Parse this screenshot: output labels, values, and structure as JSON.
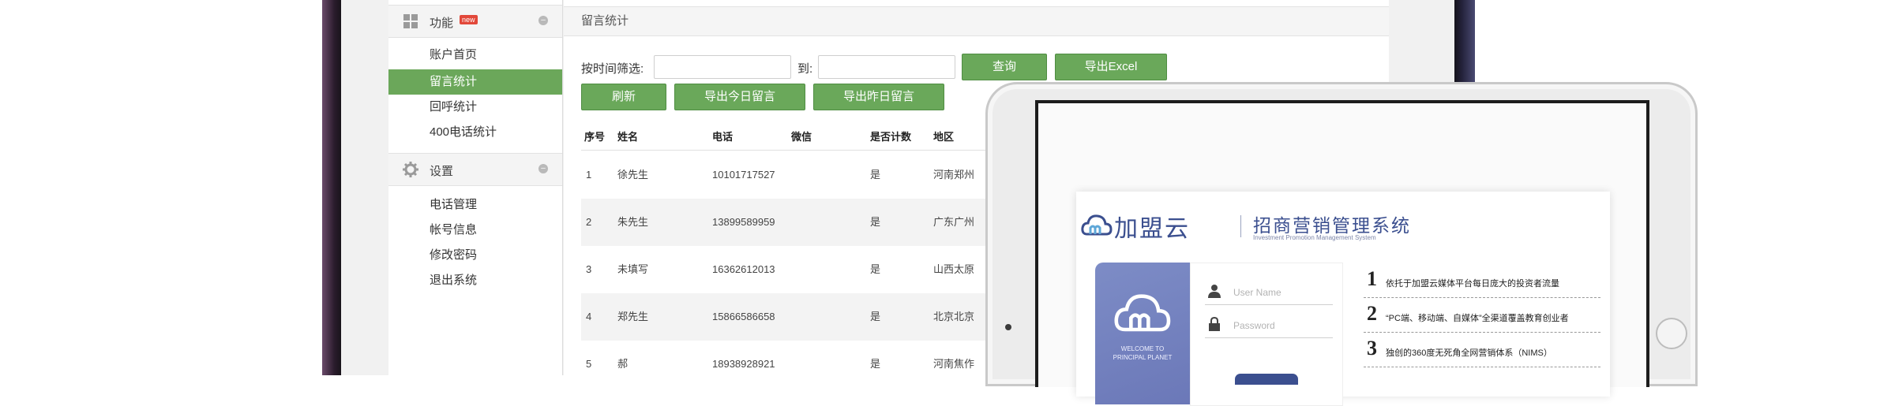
{
  "sidebar": {
    "groups": [
      {
        "title": "功能",
        "badge": "new",
        "items": [
          "账户首页",
          "留言统计",
          "回呼统计",
          "400电话统计"
        ]
      },
      {
        "title": "设置",
        "items": [
          "电话管理",
          "帐号信息",
          "修改密码",
          "退出系统"
        ]
      }
    ],
    "active_item": "留言统计"
  },
  "main": {
    "breadcrumb": "留言统计",
    "filter": {
      "label": "按时间筛选:",
      "to_label": "到:",
      "from_value": "",
      "to_value": ""
    },
    "buttons": {
      "query": "查询",
      "export_excel": "导出Excel",
      "refresh": "刷新",
      "export_today": "导出今日留言",
      "export_yesterday": "导出昨日留言"
    },
    "table": {
      "headers": [
        "序号",
        "姓名",
        "电话",
        "微信",
        "是否计数",
        "地区"
      ],
      "rows": [
        [
          "1",
          "徐先生",
          "10101717527",
          "",
          "是",
          "河南郑州"
        ],
        [
          "2",
          "朱先生",
          "13899589959",
          "",
          "是",
          "广东广州"
        ],
        [
          "3",
          "未填写",
          "16362612013",
          "",
          "是",
          "山西太原"
        ],
        [
          "4",
          "郑先生",
          "15866586658",
          "",
          "是",
          "北京北京"
        ],
        [
          "5",
          "郝",
          "18938928921",
          "",
          "是",
          "河南焦作"
        ]
      ]
    }
  },
  "tablet": {
    "brand": "加盟云",
    "system_title": "招商营销管理系统",
    "system_subtitle": "Investment Promotion Management System",
    "welcome_line1": "WELCOME TO",
    "welcome_line2": "PRINCIPAL PLANET",
    "login": {
      "username_placeholder": "User Name",
      "password_placeholder": "Password"
    },
    "features": [
      {
        "num": "1",
        "text": "依托于加盟云媒体平台每日庞大的投资者流量"
      },
      {
        "num": "2",
        "text": "“PC端、移动端、自媒体”全渠道覆盖教育创业者"
      },
      {
        "num": "3",
        "text": "独创的360度无死角全网营销体系（NIMS）"
      }
    ]
  },
  "colors": {
    "accent_green": "#6aa85a",
    "brand_blue": "#3b4f8f",
    "bezel": "#141216"
  }
}
